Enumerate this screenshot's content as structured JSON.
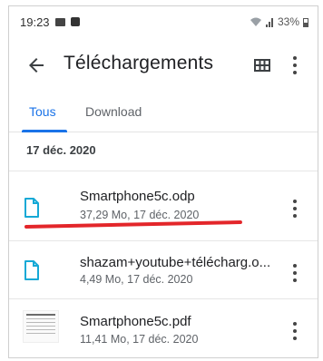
{
  "status_bar": {
    "time": "19:23",
    "battery": "33%"
  },
  "app_bar": {
    "title": "Téléchargements"
  },
  "tabs": [
    {
      "label": "Tous",
      "active": true
    },
    {
      "label": "Download",
      "active": false
    }
  ],
  "group": {
    "date_header": "17 déc. 2020"
  },
  "files": [
    {
      "name": "Smartphone5c.odp",
      "meta": "37,29 Mo, 17 déc. 2020",
      "icon": "document-icon"
    },
    {
      "name": "shazam+youtube+télécharg.o...",
      "meta": "4,49 Mo, 17 déc. 2020",
      "icon": "document-icon"
    },
    {
      "name": "Smartphone5c.pdf",
      "meta": "11,41 Mo, 17 déc. 2020",
      "icon": "pdf-thumbnail"
    }
  ],
  "colors": {
    "accent": "#1a73e8",
    "doc_icon": "#16a9d6",
    "annotation": "#e3262a"
  }
}
